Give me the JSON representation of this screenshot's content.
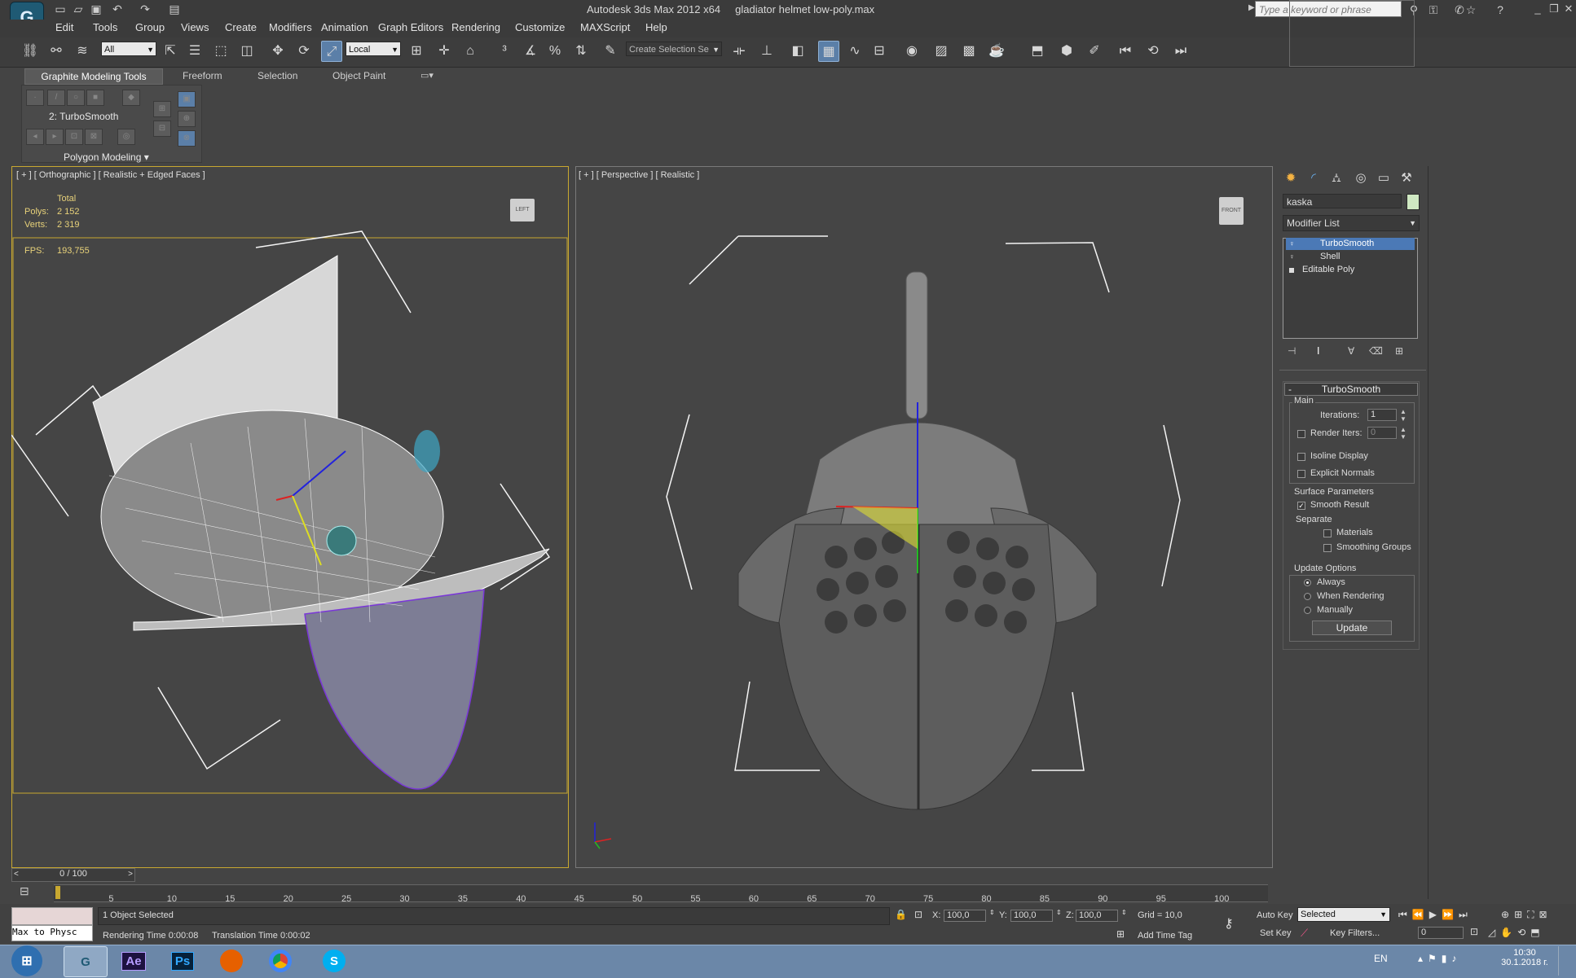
{
  "window": {
    "app_title": "Autodesk 3ds Max  2012 x64",
    "file_title": "gladiator helmet low-poly.max",
    "search_placeholder": "Type a keyword or phrase"
  },
  "menu": [
    "Edit",
    "Tools",
    "Group",
    "Views",
    "Create",
    "Modifiers",
    "Animation",
    "Graph Editors",
    "Rendering",
    "Customize",
    "MAXScript",
    "Help"
  ],
  "toolbar": {
    "selection_filter": "All",
    "reference_coord": "Local",
    "selection_set_placeholder": "Create Selection Se"
  },
  "ribbon": {
    "tabs": [
      "Graphite Modeling Tools",
      "Freeform",
      "Selection",
      "Object Paint"
    ],
    "active_modifier": "2: TurboSmooth",
    "panel_title": "Polygon Modeling"
  },
  "viewport_left": {
    "label": "[ + ] [ Orthographic ] [ Realistic + Edged Faces ]",
    "stats_header": "Total",
    "polys_label": "Polys:",
    "polys_value": "2 152",
    "verts_label": "Verts:",
    "verts_value": "2 319",
    "fps_label": "FPS:",
    "fps_value": "193,755",
    "viewcube": "LEFT"
  },
  "viewport_right": {
    "label": "[ + ] [ Perspective ] [ Realistic ]",
    "viewcube": "FRONT"
  },
  "command_panel": {
    "object_name": "kaska",
    "modifier_list": "Modifier List",
    "stack": [
      {
        "label": "TurboSmooth",
        "selected": true
      },
      {
        "label": "Shell",
        "selected": false
      },
      {
        "label": "Editable Poly",
        "selected": false
      }
    ],
    "rollout_title": "TurboSmooth",
    "main_group": "Main",
    "iterations_label": "Iterations:",
    "iterations_value": "1",
    "render_iters_label": "Render Iters:",
    "render_iters_value": "0",
    "isoline_label": "Isoline Display",
    "explicit_normals_label": "Explicit Normals",
    "surface_group": "Surface Parameters",
    "smooth_result_label": "Smooth Result",
    "separate_label": "Separate",
    "materials_label": "Materials",
    "smoothing_groups_label": "Smoothing Groups",
    "update_group": "Update Options",
    "always_label": "Always",
    "when_rendering_label": "When Rendering",
    "manually_label": "Manually",
    "update_button": "Update"
  },
  "timeline": {
    "frame_counter": "0 / 100",
    "ticks": [
      "5",
      "10",
      "15",
      "20",
      "25",
      "30",
      "35",
      "40",
      "45",
      "50",
      "55",
      "60",
      "65",
      "70",
      "75",
      "80",
      "85",
      "90",
      "95",
      "100"
    ]
  },
  "status": {
    "maxscript_listener": "Max to Physc",
    "selected_text": "1 Object Selected",
    "rendering_time": "Rendering Time  0:00:08",
    "translation_time": "Translation Time  0:00:02",
    "x_label": "X:",
    "x_value": "100,0",
    "y_label": "Y:",
    "y_value": "100,0",
    "z_label": "Z:",
    "z_value": "100,0",
    "grid": "Grid = 10,0",
    "add_time_tag": "Add Time Tag",
    "auto_key": "Auto Key",
    "set_key": "Set Key",
    "key_mode": "Selected",
    "key_filters": "Key Filters...",
    "current_frame": "0"
  },
  "taskbar": {
    "apps": [
      "start-button",
      "3ds-max",
      "after-effects",
      "photoshop",
      "firefox",
      "chrome",
      "skype"
    ],
    "ae_label": "Ae",
    "ps_label": "Ps",
    "lang": "EN",
    "time": "10:30",
    "date": "30.1.2018 г."
  },
  "colors": {
    "viewport_bg": "#454545",
    "active_border": "#c8a830",
    "selection_blue": "#4b79b6",
    "stats_yellow": "#e8d27a"
  }
}
